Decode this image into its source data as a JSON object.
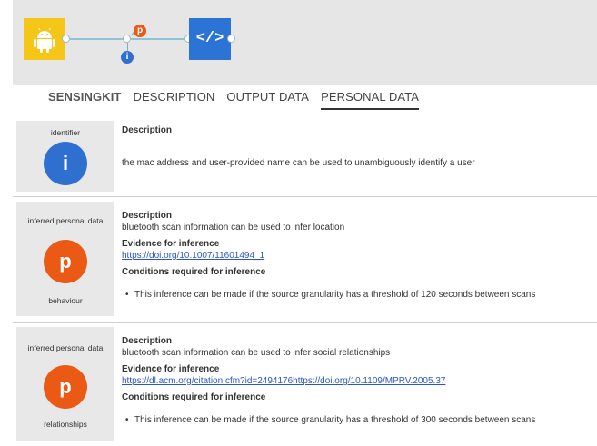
{
  "pipeline": {
    "badge_p": "p",
    "badge_i": "i",
    "code_icon": "</>"
  },
  "tabs": [
    {
      "label": "SENSINGKIT"
    },
    {
      "label": "DESCRIPTION"
    },
    {
      "label": "OUTPUT DATA"
    },
    {
      "label": "PERSONAL DATA"
    }
  ],
  "items": [
    {
      "side_title": "identifier",
      "icon_letter": "i",
      "side_bottom": "",
      "description_heading": "Description",
      "description": "the mac address and user-provided name can be used to unambiguously identify a user"
    },
    {
      "side_title": "inferred personal data",
      "icon_letter": "p",
      "side_bottom": "behaviour",
      "description_heading": "Description",
      "description": "bluetooth scan information can be used to infer location",
      "evidence_heading": "Evidence for inference",
      "evidence_link": "https://doi.org/10.1007/11601494_1",
      "conditions_heading": "Conditions required for inference",
      "condition": "This inference can be made if the source granularity has a threshold of 120 seconds between scans"
    },
    {
      "side_title": "inferred personal data",
      "icon_letter": "p",
      "side_bottom": "relationships",
      "description_heading": "Description",
      "description": "bluetooth scan information can be used to infer social relationships",
      "evidence_heading": "Evidence for inference",
      "evidence_link": "https://dl.acm.org/citation.cfm?id=2494176https://doi.org/10.1109/MPRV.2005.37",
      "conditions_heading": "Conditions required for inference",
      "condition": "This inference can be made if the source granularity has a threshold of 300 seconds between scans"
    }
  ]
}
